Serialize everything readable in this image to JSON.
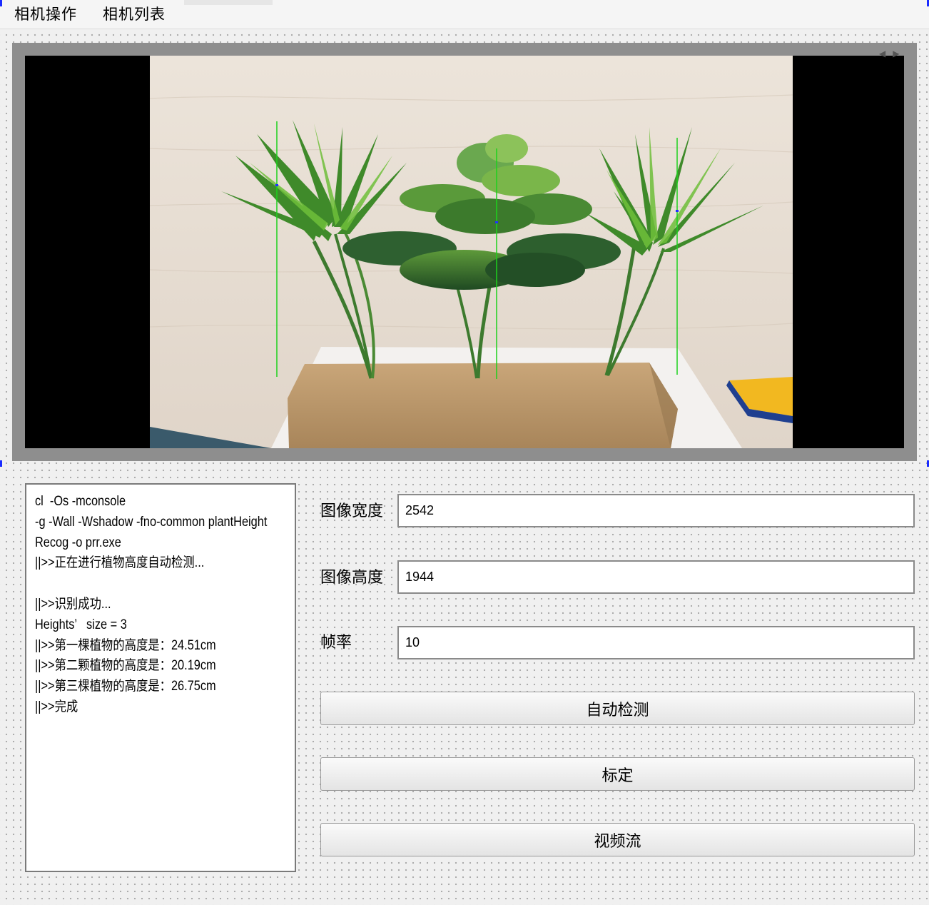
{
  "menu": {
    "items": [
      "相机操作",
      "相机列表"
    ]
  },
  "video": {
    "scene": "three-plants-height-detection",
    "marker_color": "#1dd11d"
  },
  "log": {
    "lines": [
      "cl  -Os -mconsole",
      "-g -Wall -Wshadow -fno-common plantHeight",
      "Recog -o prr.exe",
      "||>>正在进行植物高度自动检测...",
      "",
      "||>>识别成功...",
      "Heights’   size = 3",
      "||>>第一棵植物的高度是：24.51cm",
      "||>>第二颗植物的高度是：20.19cm",
      "||>>第三棵植物的高度是：26.75cm",
      "||>>完成"
    ]
  },
  "params": {
    "width_label": "图像宽度",
    "width_value": "2542",
    "height_label": "图像高度",
    "height_value": "1944",
    "fps_label": "帧率",
    "fps_value": "10"
  },
  "buttons": {
    "auto_detect": "自动检测",
    "calibrate": "标定",
    "video_stream": "视频流"
  },
  "colors": {
    "accent": "#1a2bff",
    "frame": "#8e8e8e"
  }
}
